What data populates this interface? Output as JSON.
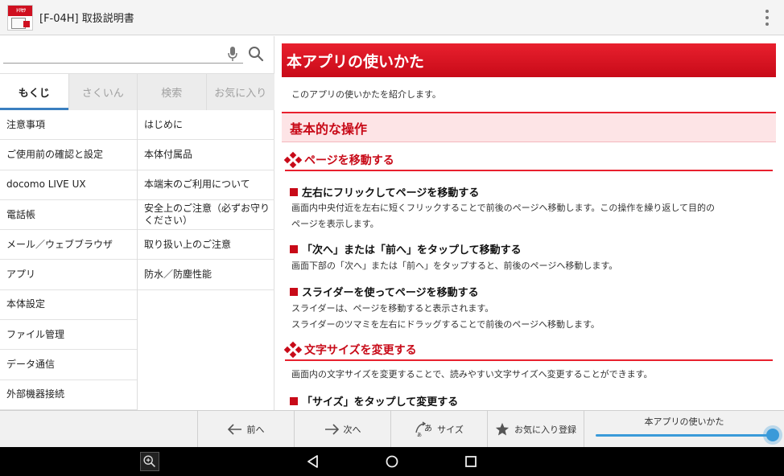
{
  "app": {
    "title": "[F-04H] 取扱説明書",
    "icon_label": "ﾄﾘｾﾂ"
  },
  "search": {
    "value": "",
    "placeholder": ""
  },
  "tabs": [
    {
      "label": "もくじ",
      "active": true
    },
    {
      "label": "さくいん",
      "active": false
    },
    {
      "label": "検索",
      "active": false
    },
    {
      "label": "お気に入り",
      "active": false
    }
  ],
  "toc": {
    "categories": [
      "注意事項",
      "ご使用前の確認と設定",
      "docomo LIVE UX",
      "電話帳",
      "メール／ウェブブラウザ",
      "アプリ",
      "本体設定",
      "ファイル管理",
      "データ通信",
      "外部機器接続"
    ],
    "subitems": [
      "はじめに",
      "本体付属品",
      "本端末のご利用について",
      "安全上のご注意（必ずお守りください）",
      "取り扱い上のご注意",
      "防水／防塵性能"
    ]
  },
  "content": {
    "title": "本アプリの使いかた",
    "intro": "このアプリの使いかたを紹介します。",
    "section": "基本的な操作",
    "sub1": {
      "heading": "ページを移動する",
      "items": [
        {
          "heading": "左右にフリックしてページを移動する",
          "text": [
            "画面内中央付近を左右に短くフリックすることで前後のページへ移動します。この操作を繰り返して目的の",
            "ページを表示します。"
          ]
        },
        {
          "heading": "「次へ」または「前へ」をタップして移動する",
          "text": [
            "画面下部の「次へ」または「前へ」をタップすると、前後のページへ移動します。"
          ]
        },
        {
          "heading": "スライダーを使ってページを移動する",
          "text": [
            "スライダーは、ページを移動すると表示されます。",
            "スライダーのツマミを左右にドラッグすることで前後のページへ移動します。"
          ]
        }
      ]
    },
    "sub2": {
      "heading": "文字サイズを変更する",
      "text": "画面内の文字サイズを変更することで、読みやすい文字サイズへ変更することができます。",
      "item_heading": "「サイズ」をタップして変更する"
    }
  },
  "toolbar": {
    "prev_label": "前へ",
    "next_label": "次へ",
    "size_label": "サイズ",
    "fav_label": "お気に入り登録",
    "slider_label": "本アプリの使いかた",
    "slider_progress": 1.0
  },
  "colors": {
    "accent": "#c80a18",
    "tab_indicator": "#3a7fc0",
    "slider": "#3a9ad9"
  },
  "icons": [
    "app-icon",
    "mic-icon",
    "search-icon",
    "overflow-menu-icon",
    "arrow-left-icon",
    "arrow-right-icon",
    "text-size-icon",
    "star-icon",
    "zoom-icon",
    "back-icon",
    "home-icon",
    "recent-apps-icon"
  ]
}
